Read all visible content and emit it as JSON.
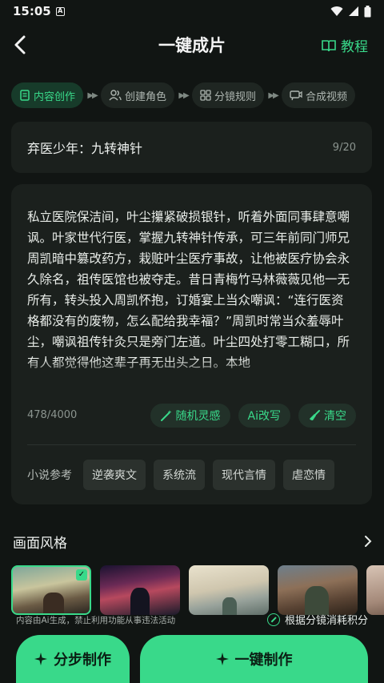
{
  "status": {
    "time": "15:05"
  },
  "header": {
    "title": "一键成片",
    "tutorial": "教程"
  },
  "steps": [
    {
      "label": "内容创作",
      "icon": "document-icon"
    },
    {
      "label": "创建角色",
      "icon": "users-icon"
    },
    {
      "label": "分镜规则",
      "icon": "grid-icon"
    },
    {
      "label": "合成视频",
      "icon": "video-icon"
    }
  ],
  "story": {
    "title": "弃医少年：九转神针",
    "title_count": "9/20",
    "text": "私立医院保洁间，叶尘攥紧破损银针，听着外面同事肆意嘲讽。叶家世代行医，掌握九转神针传承，可三年前同门师兄周凯暗中篡改药方，栽赃叶尘医疗事故，让他被医疗协会永久除名，祖传医馆也被夺走。昔日青梅竹马林薇薇见他一无所有，转头投入周凯怀抱，订婚宴上当众嘲讽：“连行医资格都没有的废物，怎么配给我幸福？”周凯时常当众羞辱叶尘，嘲讽祖传针灸只是旁门左道。叶尘四处打零工糊口，所有人都觉得他这辈子再无出头之日。本地",
    "text_count": "478/4000",
    "actions": [
      "随机灵感",
      "Ai改写",
      "清空"
    ]
  },
  "refs": {
    "label": "小说参考",
    "tags": [
      "逆袭爽文",
      "系统流",
      "现代言情",
      "虐恋情"
    ]
  },
  "style": {
    "heading": "画面风格"
  },
  "footer": {
    "disclaimer": "内容由Ai生成，禁止利用功能从事违法活动",
    "points": "根据分镜消耗积分",
    "step_button": "分步制作",
    "one_button": "一键制作"
  },
  "colors": {
    "accent": "#39d98a",
    "background": "#111513",
    "card": "#1b201d"
  }
}
